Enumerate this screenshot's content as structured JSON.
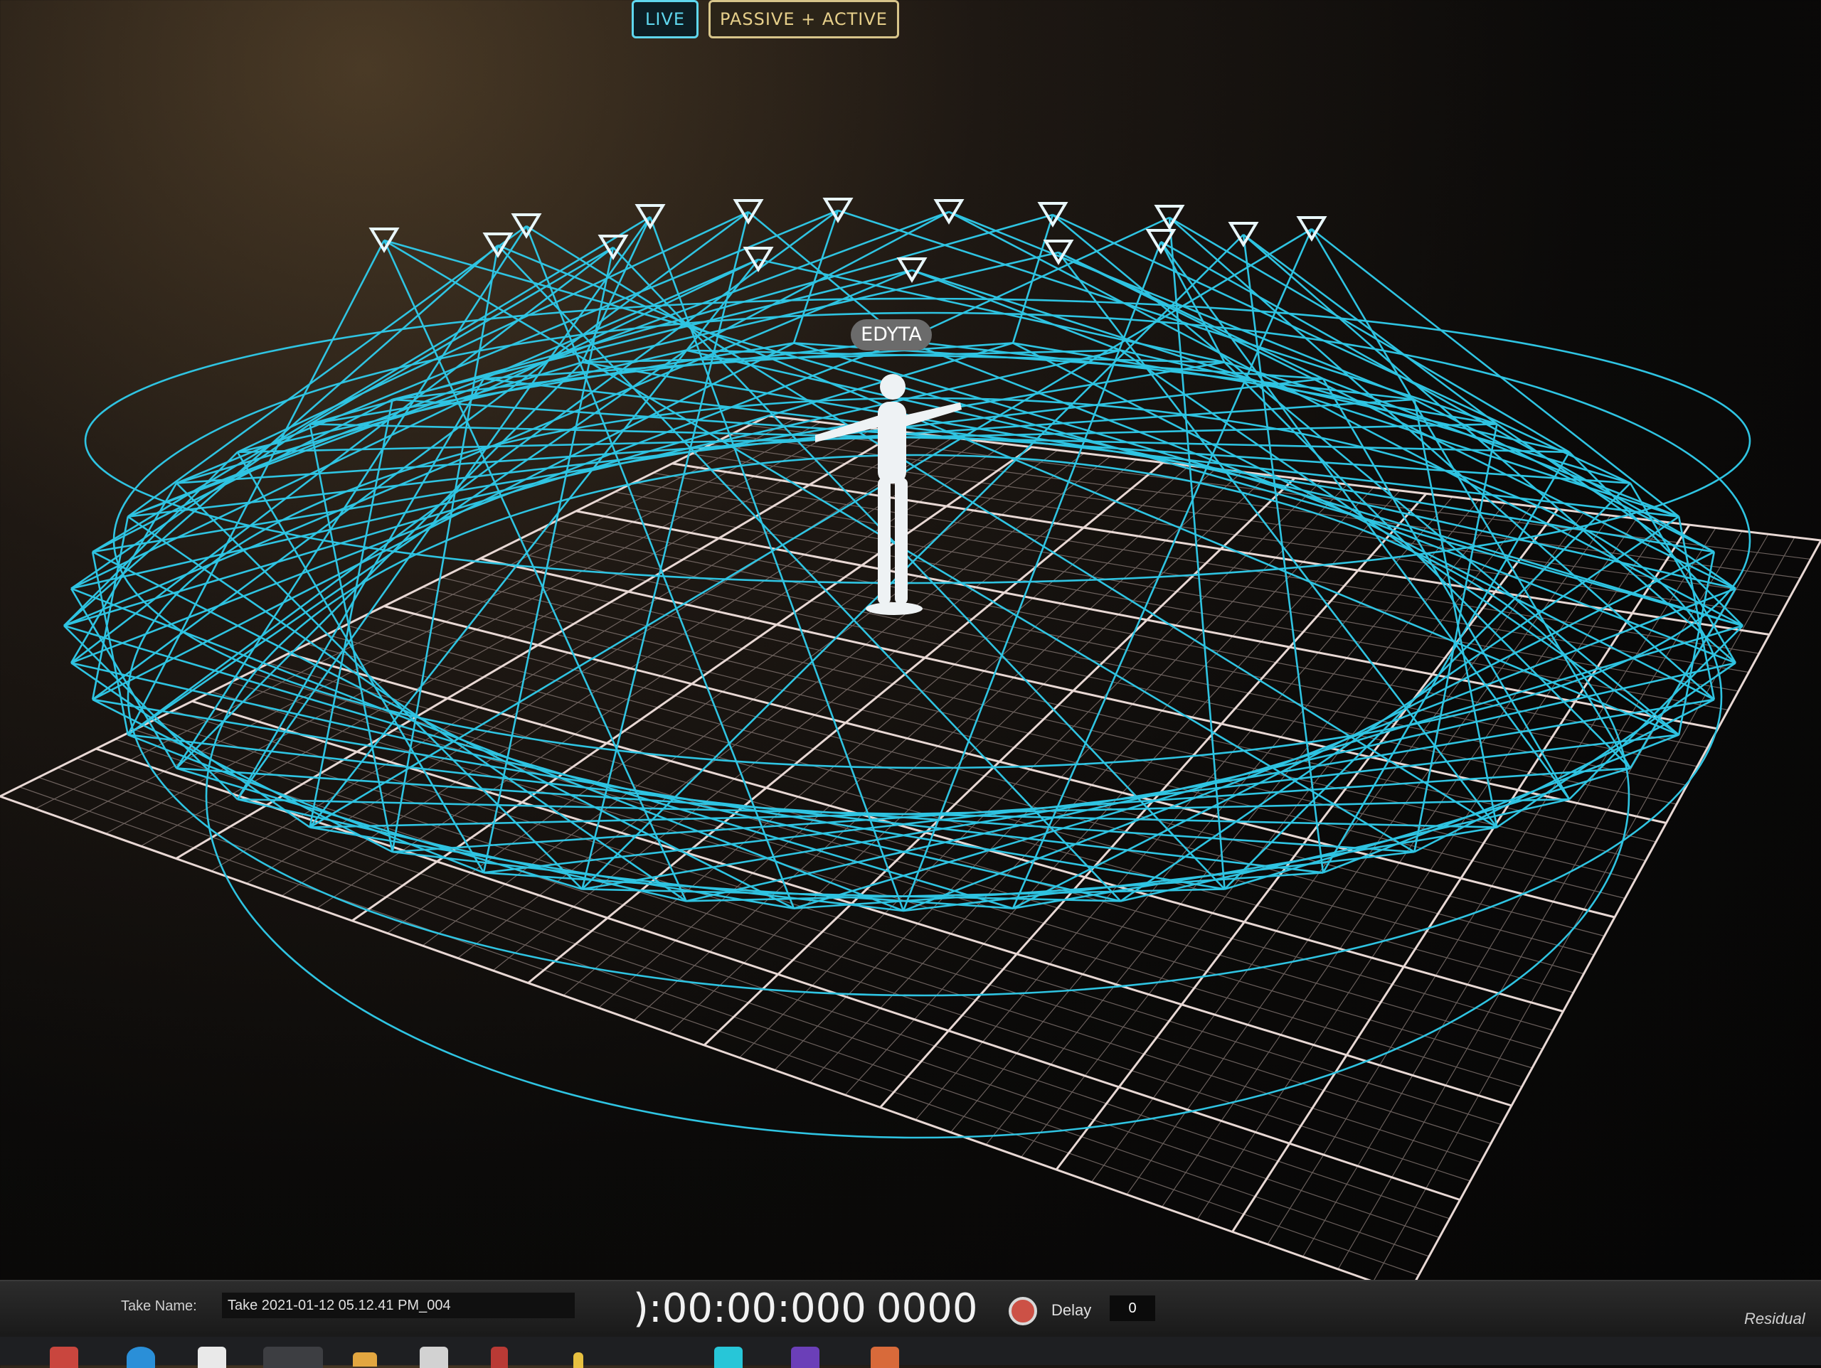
{
  "header": {
    "live_label": "LIVE",
    "mode_label": "PASSIVE + ACTIVE"
  },
  "viewport": {
    "actor_name": "EDYTA"
  },
  "status_bar": {
    "take_name_label": "Take Name:",
    "take_name_value": "Take 2021-01-12 05.12.41 PM_004",
    "timecode": "):00:00:000",
    "frame_count": "0000",
    "delay_label": "Delay",
    "delay_value": "0",
    "residual_label": "Residual"
  },
  "colors": {
    "camera_frustum": "#2fc4e2",
    "grid_major": "#e8d8d4",
    "grid_minor": "#8a7c78",
    "actor": "#eef2f4",
    "record": "#cc5146"
  },
  "icons": {
    "record": "record-icon",
    "camera": "camera-icon"
  },
  "taskbar": {
    "icons": [
      "app-icon-red",
      "edge-icon",
      "briefcase-icon",
      "app-icon-dots",
      "folder-icon",
      "disk-icon",
      "app-icon-red-2",
      "pencil-icon",
      "app-icon-cyan",
      "app-icon-purple",
      "app-icon-orange"
    ]
  }
}
